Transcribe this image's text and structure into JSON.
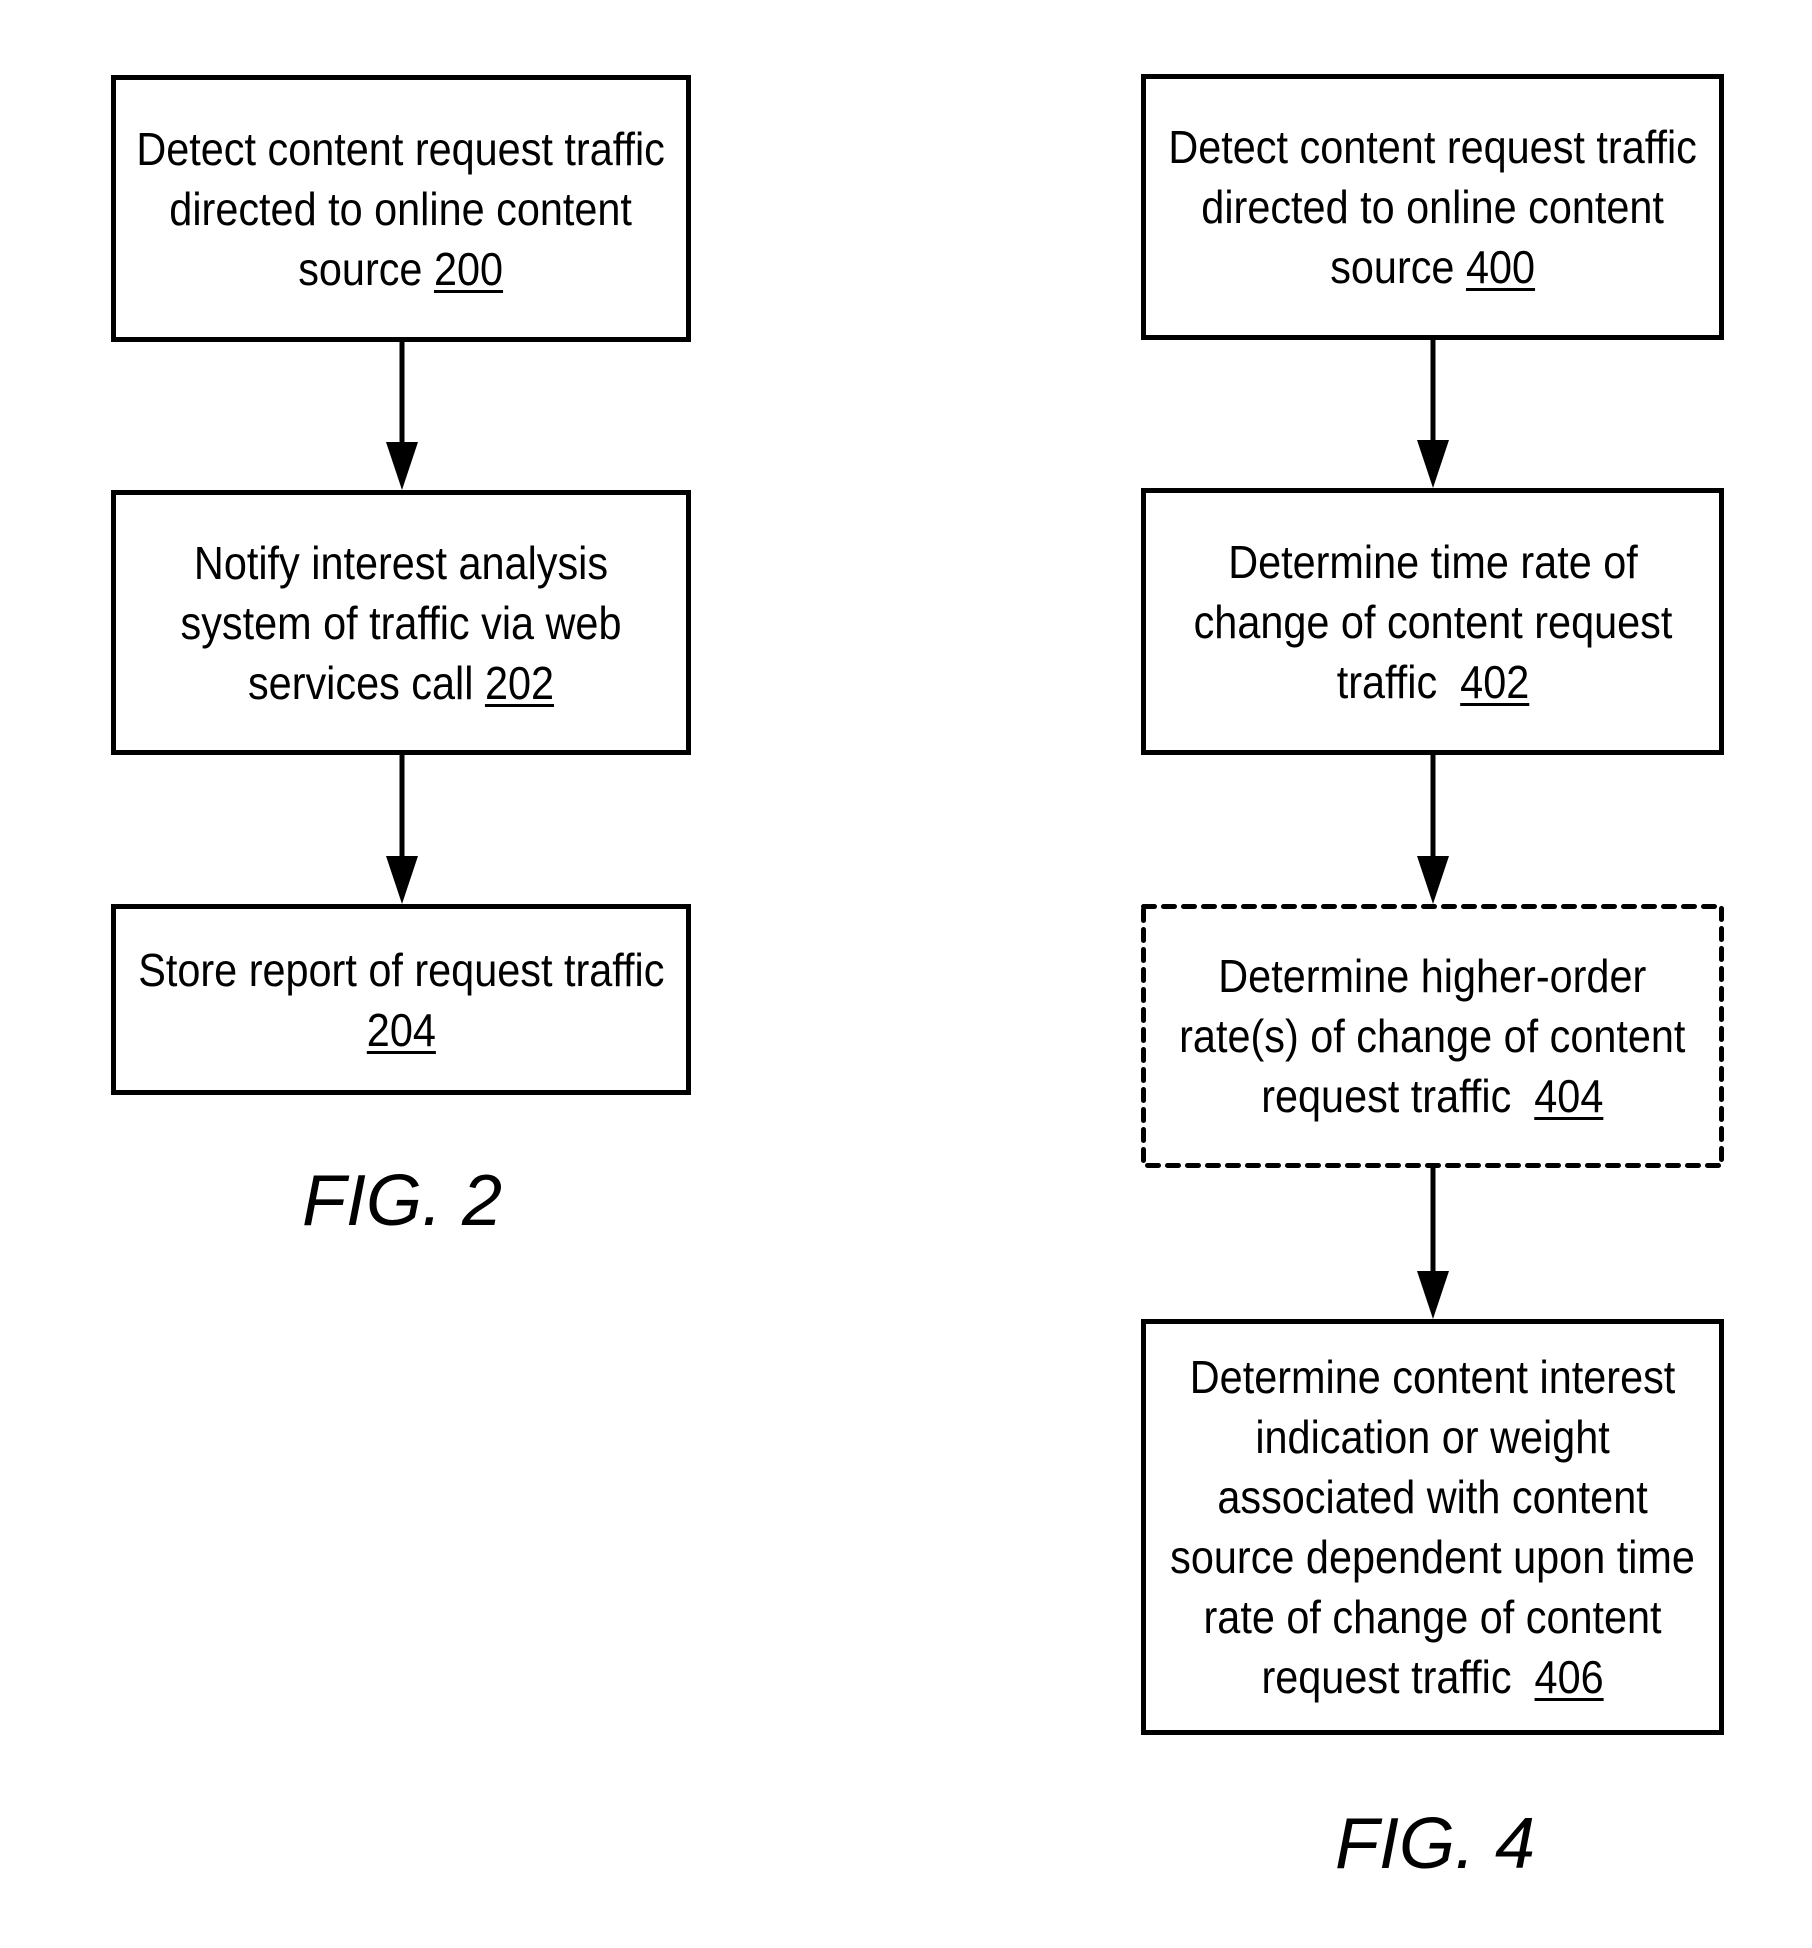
{
  "figures": [
    {
      "label": "FIG. 2",
      "steps": [
        {
          "lines": [
            "Detect content request traffic",
            "directed to online content",
            "source "
          ],
          "ref": "200",
          "style": "solid"
        },
        {
          "lines": [
            "Notify interest analysis",
            "system of traffic via web",
            "services call "
          ],
          "ref": "202",
          "style": "solid"
        },
        {
          "lines": [
            "Store report of request traffic",
            ""
          ],
          "ref": "204",
          "style": "solid"
        }
      ]
    },
    {
      "label": "FIG. 4",
      "steps": [
        {
          "lines": [
            "Detect content request traffic",
            "directed to online content",
            "source "
          ],
          "ref": "400",
          "style": "solid"
        },
        {
          "lines": [
            "Determine time rate of",
            "change of content request",
            "traffic  "
          ],
          "ref": "402",
          "style": "solid"
        },
        {
          "lines": [
            "Determine higher-order",
            "rate(s) of change of content",
            "request traffic  "
          ],
          "ref": "404",
          "style": "dashed"
        },
        {
          "lines": [
            "Determine content interest",
            "indication or weight",
            "associated with content",
            "source dependent upon time",
            "rate of change of content",
            "request traffic  "
          ],
          "ref": "406",
          "style": "solid"
        }
      ]
    }
  ],
  "connectors": [
    {
      "from": "200",
      "to": "202",
      "icon": "arrow-down"
    },
    {
      "from": "202",
      "to": "204",
      "icon": "arrow-down"
    },
    {
      "from": "400",
      "to": "402",
      "icon": "arrow-down"
    },
    {
      "from": "402",
      "to": "404",
      "icon": "arrow-down"
    },
    {
      "from": "404",
      "to": "406",
      "icon": "arrow-down"
    }
  ],
  "colors": {
    "stroke": "#000000",
    "background": "#ffffff"
  }
}
